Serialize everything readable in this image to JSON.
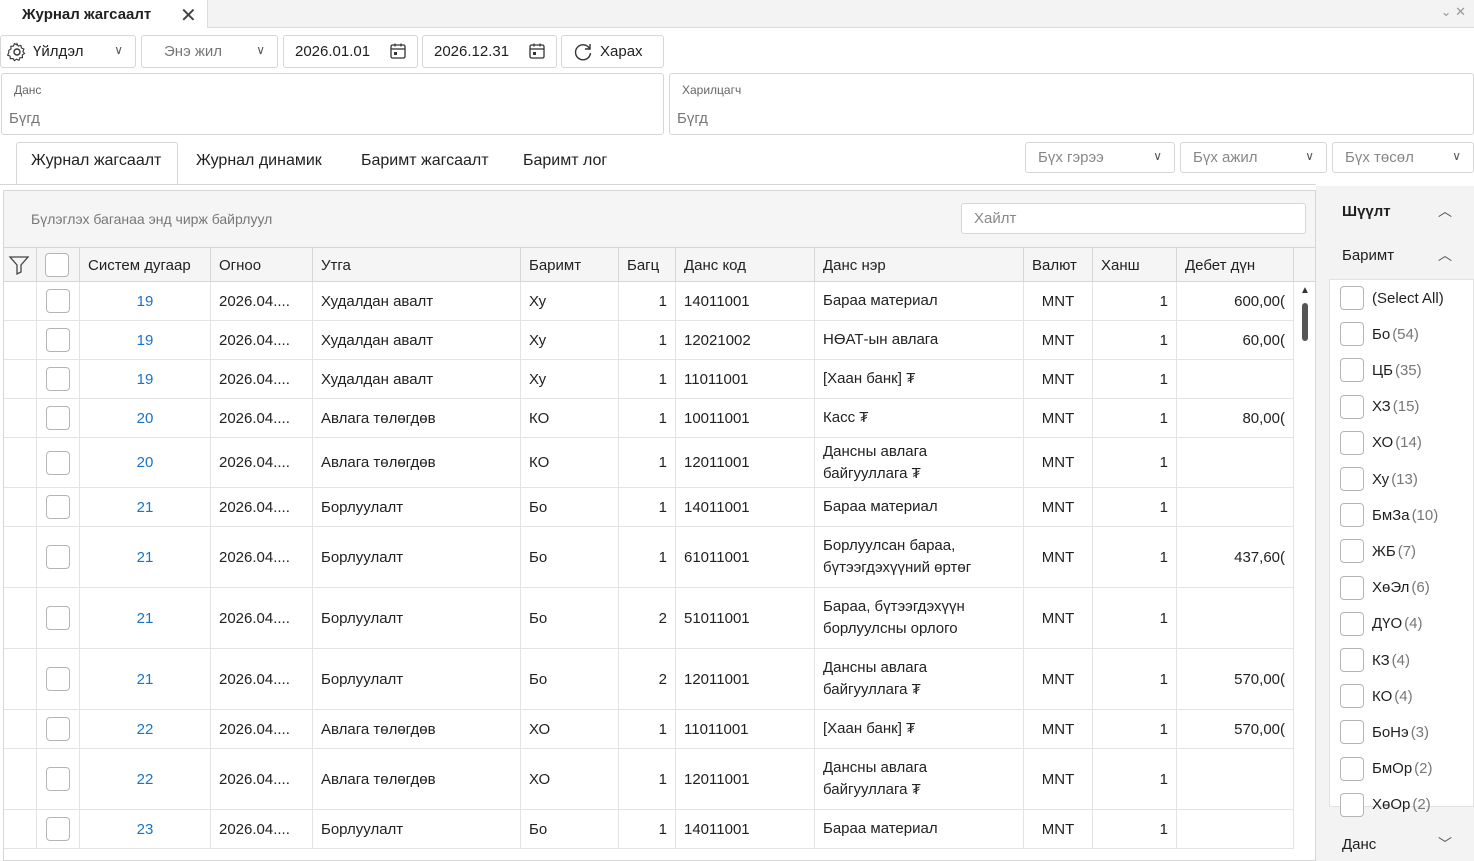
{
  "window": {
    "tab_title": "Журнал жагсаалт"
  },
  "toolbar": {
    "action_label": "Үйлдэл",
    "period_label": "Энэ жил",
    "date_from": "2026.01.01",
    "date_to": "2026.12.31",
    "view_label": "Харах"
  },
  "filters": {
    "account": {
      "label": "Данс",
      "value": "Бүгд"
    },
    "partner": {
      "label": "Харилцагч",
      "value": "Бүгд"
    }
  },
  "tabs": [
    "Журнал жагсаалт",
    "Журнал динамик",
    "Баримт жагсаалт",
    "Баримт лог"
  ],
  "combos": {
    "contract": "Бүх гэрээ",
    "work": "Бүх ажил",
    "project": "Бүх төсөл"
  },
  "grid": {
    "group_hint": "Бүлэглэх баганаа энд чирж байрлуул",
    "search_placeholder": "Хайлт",
    "columns": [
      "Систем дугаар",
      "Огноо",
      "Утга",
      "Баримт",
      "Багц",
      "Данс код",
      "Данс нэр",
      "Валют",
      "Ханш",
      "Дебет дүн"
    ],
    "rows": [
      {
        "sys": "19",
        "date": "2026.04....",
        "desc": "Худалдан авалт",
        "doc": "Ху",
        "batch": "1",
        "code": "14011001",
        "name": "Бараа материал",
        "cur": "MNT",
        "rate": "1",
        "debit": "600,00("
      },
      {
        "sys": "19",
        "date": "2026.04....",
        "desc": "Худалдан авалт",
        "doc": "Ху",
        "batch": "1",
        "code": "12021002",
        "name": "НӨАТ-ын авлага",
        "cur": "MNT",
        "rate": "1",
        "debit": "60,00("
      },
      {
        "sys": "19",
        "date": "2026.04....",
        "desc": "Худалдан авалт",
        "doc": "Ху",
        "batch": "1",
        "code": "11011001",
        "name": "[Хаан банк] ₮",
        "cur": "MNT",
        "rate": "1",
        "debit": ""
      },
      {
        "sys": "20",
        "date": "2026.04....",
        "desc": "Авлага төлөгдөв",
        "doc": "КО",
        "batch": "1",
        "code": "10011001",
        "name": "Касс ₮",
        "cur": "MNT",
        "rate": "1",
        "debit": "80,00("
      },
      {
        "sys": "20",
        "date": "2026.04....",
        "desc": "Авлага төлөгдөв",
        "doc": "КО",
        "batch": "1",
        "code": "12011001",
        "name": "Дансны авлага байгууллага ₮",
        "cur": "MNT",
        "rate": "1",
        "debit": ""
      },
      {
        "sys": "21",
        "date": "2026.04....",
        "desc": "Борлуулалт",
        "doc": "Бо",
        "batch": "1",
        "code": "14011001",
        "name": "Бараа материал",
        "cur": "MNT",
        "rate": "1",
        "debit": ""
      },
      {
        "sys": "21",
        "date": "2026.04....",
        "desc": "Борлуулалт",
        "doc": "Бо",
        "batch": "1",
        "code": "61011001",
        "name": "Борлуулсан бараа, бүтээгдэхүүний өртөг",
        "cur": "MNT",
        "rate": "1",
        "debit": "437,60("
      },
      {
        "sys": "21",
        "date": "2026.04....",
        "desc": "Борлуулалт",
        "doc": "Бо",
        "batch": "2",
        "code": "51011001",
        "name": "Бараа, бүтээгдэхүүн борлуулсны орлого",
        "cur": "MNT",
        "rate": "1",
        "debit": ""
      },
      {
        "sys": "21",
        "date": "2026.04....",
        "desc": "Борлуулалт",
        "doc": "Бо",
        "batch": "2",
        "code": "12011001",
        "name": "Дансны авлага байгууллага ₮",
        "cur": "MNT",
        "rate": "1",
        "debit": "570,00("
      },
      {
        "sys": "22",
        "date": "2026.04....",
        "desc": "Авлага төлөгдөв",
        "doc": "ХО",
        "batch": "1",
        "code": "11011001",
        "name": "[Хаан банк] ₮",
        "cur": "MNT",
        "rate": "1",
        "debit": "570,00("
      },
      {
        "sys": "22",
        "date": "2026.04....",
        "desc": "Авлага төлөгдөв",
        "doc": "ХО",
        "batch": "1",
        "code": "12011001",
        "name": "Дансны авлага байгууллага ₮",
        "cur": "MNT",
        "rate": "1",
        "debit": ""
      },
      {
        "sys": "23",
        "date": "2026.04....",
        "desc": "Борлуулалт",
        "doc": "Бо",
        "batch": "1",
        "code": "14011001",
        "name": "Бараа материал",
        "cur": "MNT",
        "rate": "1",
        "debit": ""
      }
    ]
  },
  "side_panel": {
    "filter_title": "Шүүлт",
    "doc_section": "Баримт",
    "account_section": "Данс",
    "items": [
      {
        "label": "(Select All)",
        "count": ""
      },
      {
        "label": "Бо",
        "count": "(54)"
      },
      {
        "label": "ЦБ",
        "count": "(35)"
      },
      {
        "label": "ХЗ",
        "count": "(15)"
      },
      {
        "label": "ХО",
        "count": "(14)"
      },
      {
        "label": "Ху",
        "count": "(13)"
      },
      {
        "label": "БмЗа",
        "count": "(10)"
      },
      {
        "label": "ЖБ",
        "count": "(7)"
      },
      {
        "label": "ХөЭл",
        "count": "(6)"
      },
      {
        "label": "ДҮО",
        "count": "(4)"
      },
      {
        "label": "КЗ",
        "count": "(4)"
      },
      {
        "label": "КО",
        "count": "(4)"
      },
      {
        "label": "БоНэ",
        "count": "(3)"
      },
      {
        "label": "БмОр",
        "count": "(2)"
      },
      {
        "label": "ХөОр",
        "count": "(2)"
      }
    ]
  },
  "colors": {
    "link": "#1a73c8",
    "border": "#d6d6d6",
    "header_bg": "#f5f5f5"
  }
}
